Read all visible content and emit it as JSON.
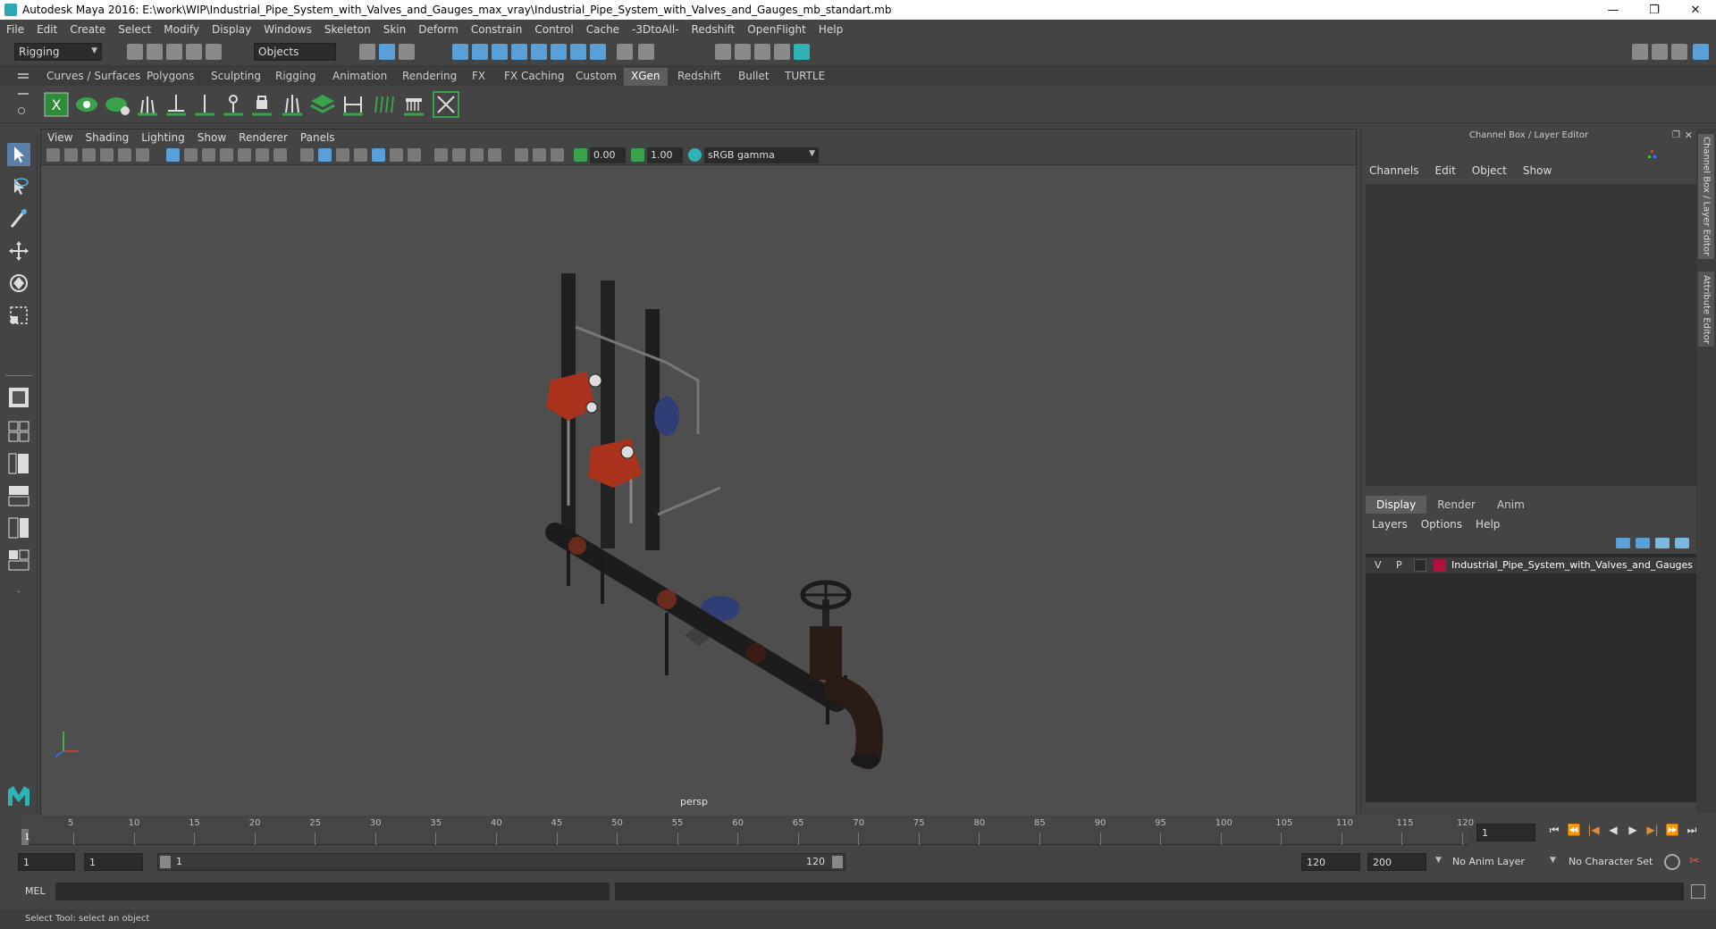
{
  "window": {
    "title": "Autodesk Maya 2016: E:\\work\\WIP\\Industrial_Pipe_System_with_Valves_and_Gauges_max_vray\\Industrial_Pipe_System_with_Valves_and_Gauges_mb_standart.mb",
    "minimize": "—",
    "restore": "❐",
    "close": "✕"
  },
  "menubar": {
    "items": [
      "File",
      "Edit",
      "Create",
      "Select",
      "Modify",
      "Display",
      "Windows",
      "Skeleton",
      "Skin",
      "Deform",
      "Constrain",
      "Control",
      "Cache",
      "-3DtoAll-",
      "Redshift",
      "OpenFlight",
      "Help"
    ]
  },
  "statusline": {
    "menuset": "Rigging",
    "selection_mode": "Objects"
  },
  "shelf": {
    "tabs": [
      "Curves / Surfaces",
      "Polygons",
      "Sculpting",
      "Rigging",
      "Animation",
      "Rendering",
      "FX",
      "FX Caching",
      "Custom",
      "XGen",
      "Redshift",
      "Bullet",
      "TURTLE"
    ],
    "active_tab": "XGen"
  },
  "viewport": {
    "menu": [
      "View",
      "Shading",
      "Lighting",
      "Show",
      "Renderer",
      "Panels"
    ],
    "exposure": "0.00",
    "gamma": "1.00",
    "color_space": "sRGB gamma",
    "camera_label": "persp"
  },
  "channelbox": {
    "title": "Channel Box / Layer Editor",
    "menu": [
      "Channels",
      "Edit",
      "Object",
      "Show"
    ],
    "layer_tabs": [
      "Display",
      "Render",
      "Anim"
    ],
    "active_layer_tab": "Display",
    "layer_menu": [
      "Layers",
      "Options",
      "Help"
    ],
    "layer": {
      "visible": "V",
      "playback": "P",
      "name": "Industrial_Pipe_System_with_Valves_and_Gauges",
      "color": "#b0103a"
    },
    "side_tabs": [
      "Channel Box / Layer Editor",
      "Attribute Editor"
    ]
  },
  "timeline": {
    "ticks": [
      1,
      5,
      10,
      15,
      20,
      25,
      30,
      35,
      40,
      45,
      50,
      55,
      60,
      65,
      70,
      75,
      80,
      85,
      90,
      95,
      100,
      105,
      110,
      115,
      120
    ],
    "current_frame": "1",
    "current_frame_field": "1"
  },
  "range": {
    "start_field": "1",
    "playback_start": "1",
    "range_start_label": "1",
    "range_end_label": "120",
    "playback_end": "120",
    "end_field": "200",
    "anim_layer": "No Anim Layer",
    "character_set": "No Character Set"
  },
  "commandline": {
    "label": "MEL"
  },
  "helpline": {
    "text": "Select Tool: select an object"
  }
}
